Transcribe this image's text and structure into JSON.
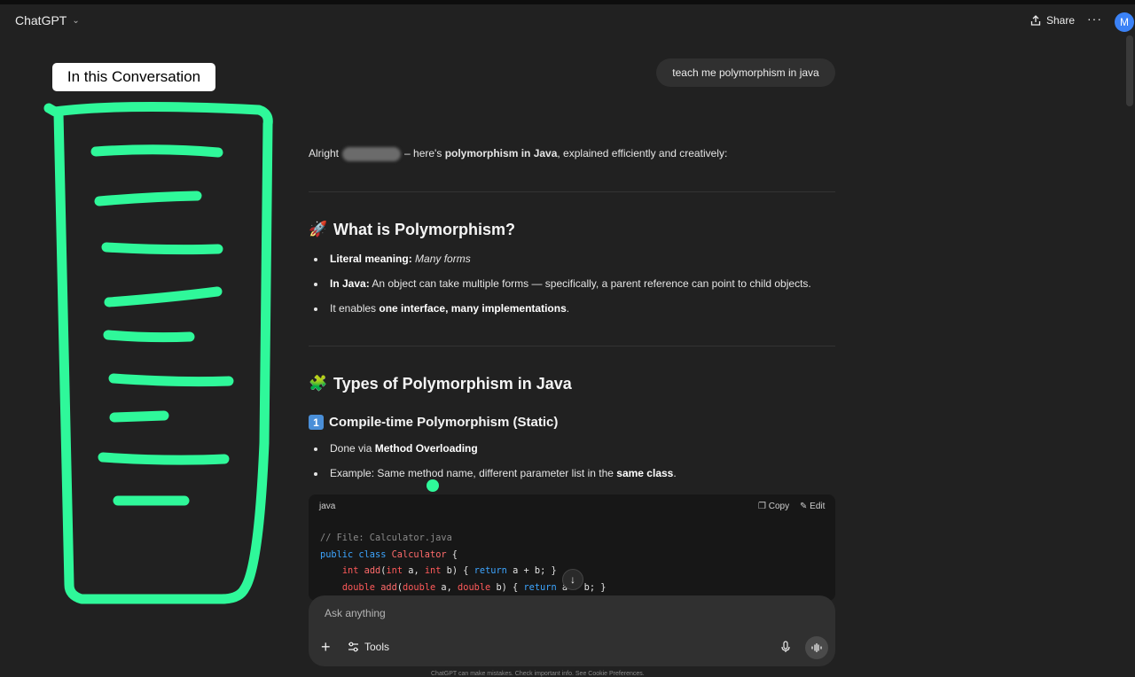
{
  "header": {
    "model": "ChatGPT",
    "share_label": "Share",
    "more": "···",
    "avatar_initial": "M"
  },
  "annotation": {
    "label": "In this Conversation",
    "accent_color": "#2ff89a"
  },
  "chat": {
    "user_message": "teach me polymorphism in java",
    "intro": {
      "pre": "Alright",
      "mid": "– here's",
      "bold": "polymorphism in Java",
      "post": ", explained efficiently and creatively:"
    },
    "section1": {
      "emoji": "🚀",
      "title": "What is Polymorphism?",
      "bullets": [
        {
          "bold": "Literal meaning:",
          "italic": "Many forms"
        },
        {
          "bold": "In Java:",
          "text": "An object can take multiple forms — specifically, a parent reference can point to child objects."
        },
        {
          "pre": "It enables ",
          "bold": "one interface, many implementations",
          "post": "."
        }
      ]
    },
    "section2": {
      "emoji": "🧩",
      "title": "Types of Polymorphism in Java",
      "sub_number": "1",
      "sub_title": "Compile-time Polymorphism (Static)",
      "bullets": [
        {
          "pre": "Done via ",
          "bold": "Method Overloading"
        },
        {
          "pre": "Example: Same method name, different parameter list in the ",
          "bold": "same class",
          "post": "."
        }
      ]
    },
    "code": {
      "language": "java",
      "copy_label": "Copy",
      "edit_label": "Edit",
      "lines": [
        "// File: Calculator.java",
        "public class Calculator {",
        "    int add(int a, int b) { return a + b; }",
        "    double add(double a, double b) { return a + b; }"
      ]
    }
  },
  "composer": {
    "placeholder": "Ask anything",
    "tools_label": "Tools"
  },
  "footer": "ChatGPT can make mistakes. Check important info. See Cookie Preferences."
}
